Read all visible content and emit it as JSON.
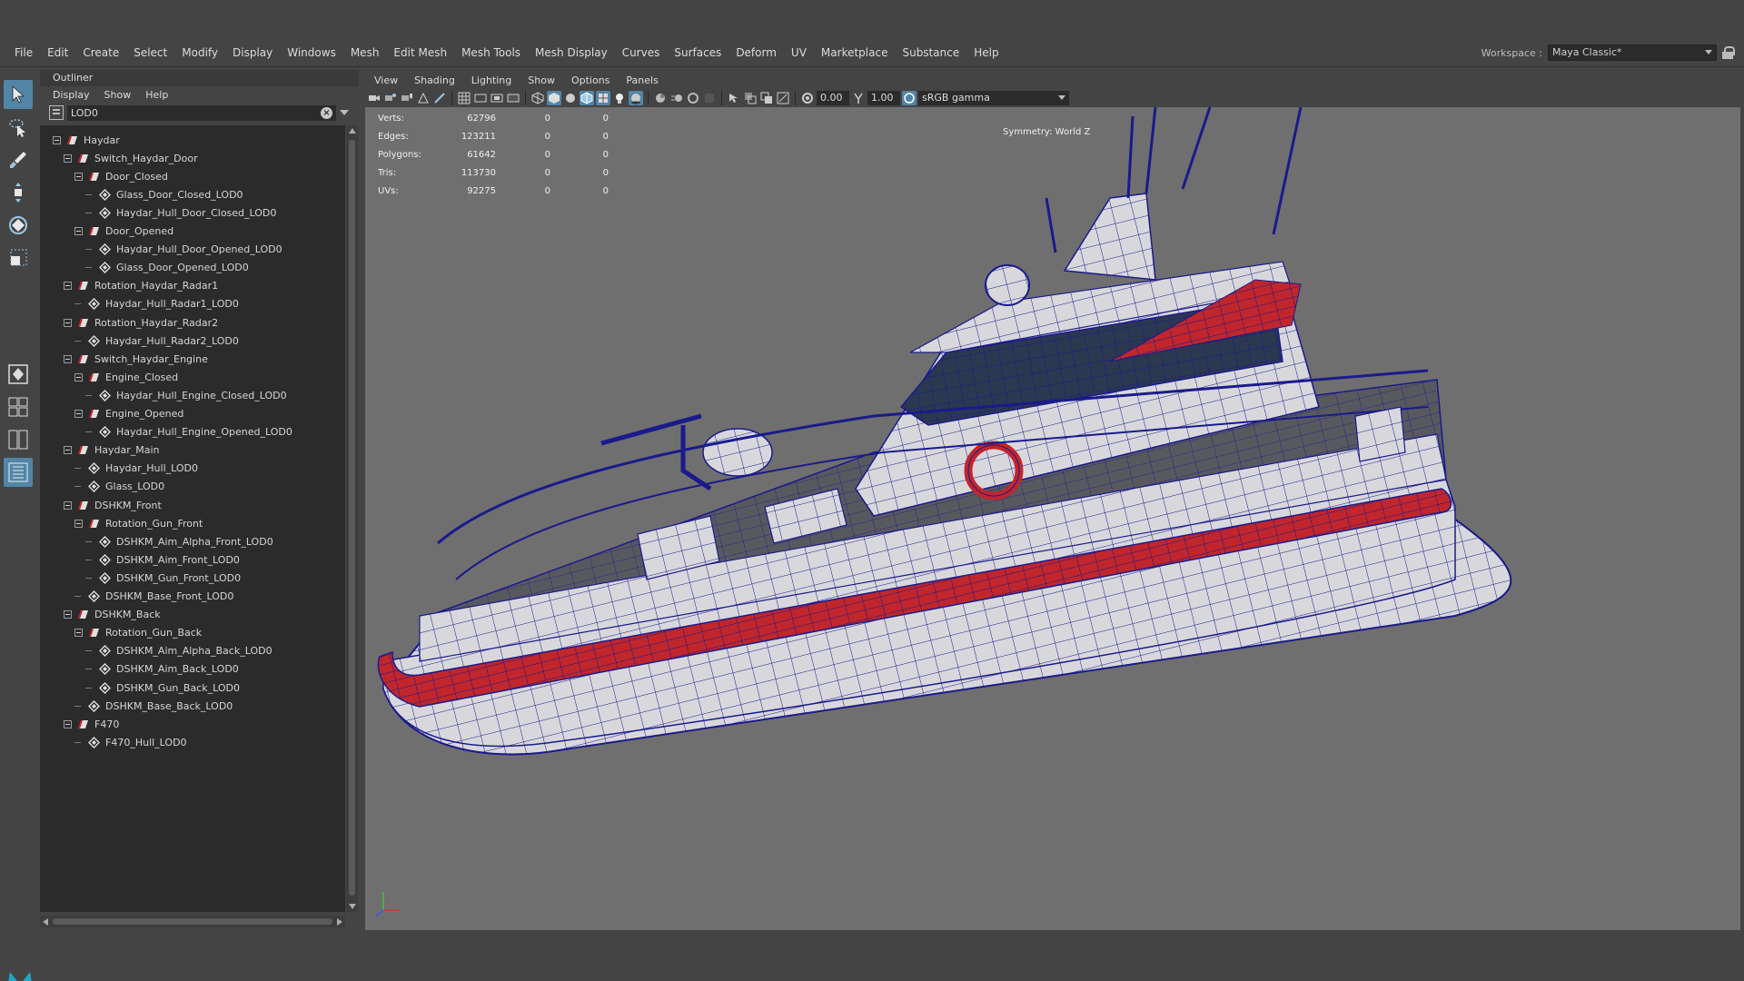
{
  "menubar": {
    "items": [
      "File",
      "Edit",
      "Create",
      "Select",
      "Modify",
      "Display",
      "Windows",
      "Mesh",
      "Edit Mesh",
      "Mesh Tools",
      "Mesh Display",
      "Curves",
      "Surfaces",
      "Deform",
      "UV",
      "Marketplace",
      "Substance",
      "Help"
    ]
  },
  "workspace": {
    "label": "Workspace :",
    "value": "Maya Classic*"
  },
  "outliner": {
    "title": "Outliner",
    "menu": [
      "Display",
      "Show",
      "Help"
    ],
    "search_value": "LOD0",
    "tree": [
      {
        "label": "Haydar",
        "depth": 0,
        "type": "group",
        "expanded": true
      },
      {
        "label": "Switch_Haydar_Door",
        "depth": 1,
        "type": "group",
        "expanded": true
      },
      {
        "label": "Door_Closed",
        "depth": 2,
        "type": "group",
        "expanded": true
      },
      {
        "label": "Glass_Door_Closed_LOD0",
        "depth": 3,
        "type": "mesh"
      },
      {
        "label": "Haydar_Hull_Door_Closed_LOD0",
        "depth": 3,
        "type": "mesh"
      },
      {
        "label": "Door_Opened",
        "depth": 2,
        "type": "group",
        "expanded": true
      },
      {
        "label": "Haydar_Hull_Door_Opened_LOD0",
        "depth": 3,
        "type": "mesh"
      },
      {
        "label": "Glass_Door_Opened_LOD0",
        "depth": 3,
        "type": "mesh"
      },
      {
        "label": "Rotation_Haydar_Radar1",
        "depth": 1,
        "type": "group",
        "expanded": true
      },
      {
        "label": "Haydar_Hull_Radar1_LOD0",
        "depth": 2,
        "type": "mesh"
      },
      {
        "label": "Rotation_Haydar_Radar2",
        "depth": 1,
        "type": "group",
        "expanded": true
      },
      {
        "label": "Haydar_Hull_Radar2_LOD0",
        "depth": 2,
        "type": "mesh"
      },
      {
        "label": "Switch_Haydar_Engine",
        "depth": 1,
        "type": "group",
        "expanded": true
      },
      {
        "label": "Engine_Closed",
        "depth": 2,
        "type": "group",
        "expanded": true
      },
      {
        "label": "Haydar_Hull_Engine_Closed_LOD0",
        "depth": 3,
        "type": "mesh"
      },
      {
        "label": "Engine_Opened",
        "depth": 2,
        "type": "group",
        "expanded": true
      },
      {
        "label": "Haydar_Hull_Engine_Opened_LOD0",
        "depth": 3,
        "type": "mesh"
      },
      {
        "label": "Haydar_Main",
        "depth": 1,
        "type": "group",
        "expanded": true
      },
      {
        "label": "Haydar_Hull_LOD0",
        "depth": 2,
        "type": "mesh"
      },
      {
        "label": "Glass_LOD0",
        "depth": 2,
        "type": "mesh"
      },
      {
        "label": "DSHKM_Front",
        "depth": 1,
        "type": "group",
        "expanded": true
      },
      {
        "label": "Rotation_Gun_Front",
        "depth": 2,
        "type": "group",
        "expanded": true
      },
      {
        "label": "DSHKM_Aim_Alpha_Front_LOD0",
        "depth": 3,
        "type": "mesh"
      },
      {
        "label": "DSHKM_Aim_Front_LOD0",
        "depth": 3,
        "type": "mesh"
      },
      {
        "label": "DSHKM_Gun_Front_LOD0",
        "depth": 3,
        "type": "mesh"
      },
      {
        "label": "DSHKM_Base_Front_LOD0",
        "depth": 2,
        "type": "mesh"
      },
      {
        "label": "DSHKM_Back",
        "depth": 1,
        "type": "group",
        "expanded": true
      },
      {
        "label": "Rotation_Gun_Back",
        "depth": 2,
        "type": "group",
        "expanded": true
      },
      {
        "label": "DSHKM_Aim_Alpha_Back_LOD0",
        "depth": 3,
        "type": "mesh"
      },
      {
        "label": "DSHKM_Aim_Back_LOD0",
        "depth": 3,
        "type": "mesh"
      },
      {
        "label": "DSHKM_Gun_Back_LOD0",
        "depth": 3,
        "type": "mesh"
      },
      {
        "label": "DSHKM_Base_Back_LOD0",
        "depth": 2,
        "type": "mesh"
      },
      {
        "label": "F470",
        "depth": 1,
        "type": "group",
        "expanded": true
      },
      {
        "label": "F470_Hull_LOD0",
        "depth": 2,
        "type": "mesh"
      }
    ]
  },
  "viewport": {
    "menu": [
      "View",
      "Shading",
      "Lighting",
      "Show",
      "Options",
      "Panels"
    ],
    "exposure": "0.00",
    "gamma": "1.00",
    "color_space": "sRGB gamma",
    "symmetry": "Symmetry: World Z",
    "hud": [
      {
        "label": "Verts:",
        "value": "62796",
        "c1": "0",
        "c2": "0"
      },
      {
        "label": "Edges:",
        "value": "123211",
        "c1": "0",
        "c2": "0"
      },
      {
        "label": "Polygons:",
        "value": "61642",
        "c1": "0",
        "c2": "0"
      },
      {
        "label": "Tris:",
        "value": "113730",
        "c1": "0",
        "c2": "0"
      },
      {
        "label": "UVs:",
        "value": "92275",
        "c1": "0",
        "c2": "0"
      }
    ]
  },
  "colors": {
    "accent": "#5285a6",
    "wire": "#1a1a8c",
    "hull_red": "#c0262b",
    "viewport_bg": "#6f6f6f"
  }
}
